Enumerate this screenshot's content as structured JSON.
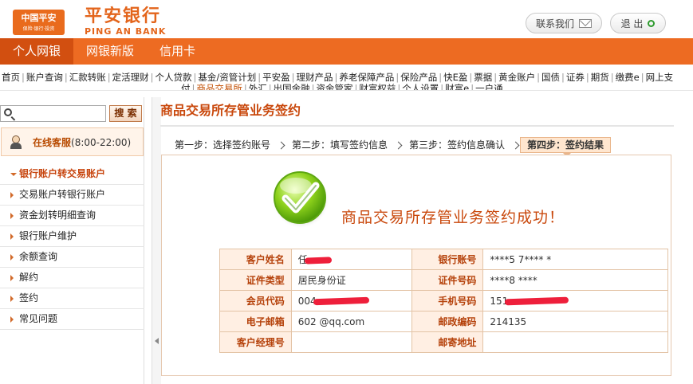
{
  "header": {
    "logo": {
      "line1": "中国平安",
      "line2": "保险·银行·投资"
    },
    "brand_cn": "平安银行",
    "brand_en": "PING AN BANK",
    "contact_label": "联系我们",
    "logout_label": "退 出"
  },
  "main_nav": {
    "tabs": [
      {
        "label": "个人网银",
        "active": true
      },
      {
        "label": "网银新版",
        "active": false
      },
      {
        "label": "信用卡",
        "active": false
      }
    ]
  },
  "sub_nav": {
    "row1": [
      "首页",
      "账户查询",
      "汇款转账",
      "定活理财",
      "个人贷款",
      "基金/资管计划",
      "平安盈",
      "理财产品",
      "养老保障产品",
      "保险产品",
      "快E盈",
      "票据",
      "黄金账户",
      "国债",
      "证券",
      "期货",
      "缴费e",
      "网上支"
    ],
    "row2": [
      "付",
      "商品交易所",
      "外汇",
      "出国金融",
      "资金管家",
      "财富权益",
      "个人设置",
      "财富e",
      "一户通"
    ],
    "current": "商品交易所"
  },
  "sidebar": {
    "search_placeholder": "",
    "search_button": "搜 索",
    "service_label": "在线客服",
    "service_hours": "(8:00-22:00)",
    "menu": [
      {
        "label": "银行账户转交易账户",
        "active": true
      },
      {
        "label": "交易账户转银行账户",
        "active": false
      },
      {
        "label": "资金划转明细查询",
        "active": false
      },
      {
        "label": "银行账户维护",
        "active": false
      },
      {
        "label": "余额查询",
        "active": false
      },
      {
        "label": "解约",
        "active": false
      },
      {
        "label": "签约",
        "active": false
      },
      {
        "label": "常见问题",
        "active": false
      }
    ]
  },
  "content": {
    "title": "商品交易所存管业务签约",
    "steps": [
      "第一步：选择签约账号",
      "第二步：填写签约信息",
      "第三步：签约信息确认",
      "第四步：签约结果"
    ],
    "success_message": "商品交易所存管业务签约成功！",
    "table": {
      "rows": [
        [
          {
            "k": "客户姓名",
            "v": "任"
          },
          {
            "k": "银行账号",
            "v": "****5 7**** *"
          }
        ],
        [
          {
            "k": "证件类型",
            "v": "居民身份证"
          },
          {
            "k": "证件号码",
            "v": "****8 ****"
          }
        ],
        [
          {
            "k": "会员代码",
            "v": "004"
          },
          {
            "k": "手机号码",
            "v": "151"
          }
        ],
        [
          {
            "k": "电子邮箱",
            "v": "602 @qq.com"
          },
          {
            "k": "邮政编码",
            "v": "214135"
          }
        ],
        [
          {
            "k": "客户经理号",
            "v": ""
          },
          {
            "k": "邮寄地址",
            "v": ""
          }
        ]
      ]
    }
  },
  "colors": {
    "brand_orange": "#ed6b22",
    "active_tab": "#d24f10",
    "title_red": "#c9480c",
    "redaction": "#ee1f3b"
  }
}
